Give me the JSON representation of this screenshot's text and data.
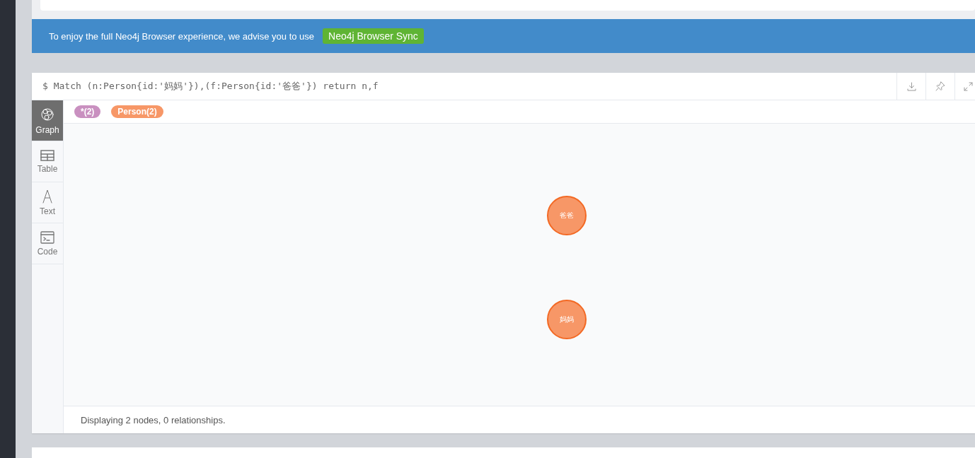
{
  "banner": {
    "message": "To enjoy the full Neo4j Browser experience, we advise you to use",
    "link": "Neo4j Browser Sync"
  },
  "frame": {
    "query": "$ Match (n:Person{id:'妈妈'}),(f:Person{id:'爸爸'}) return n,f",
    "actions": [
      {
        "kind": "download"
      },
      {
        "kind": "pin"
      },
      {
        "kind": "expand"
      }
    ],
    "views": [
      {
        "label": "Graph",
        "kind": "graph",
        "selected": true
      },
      {
        "label": "Table",
        "kind": "table",
        "selected": false
      },
      {
        "label": "Text",
        "kind": "text",
        "selected": false
      },
      {
        "label": "Code",
        "kind": "code",
        "selected": false
      }
    ],
    "legend": [
      {
        "label": "*(2)",
        "color": "#c990c0"
      },
      {
        "label": "Person(2)",
        "color": "#f79767"
      }
    ],
    "nodes": [
      {
        "label": "爸爸"
      },
      {
        "label": "妈妈"
      }
    ],
    "status": "Displaying 2 nodes, 0 relationships."
  }
}
